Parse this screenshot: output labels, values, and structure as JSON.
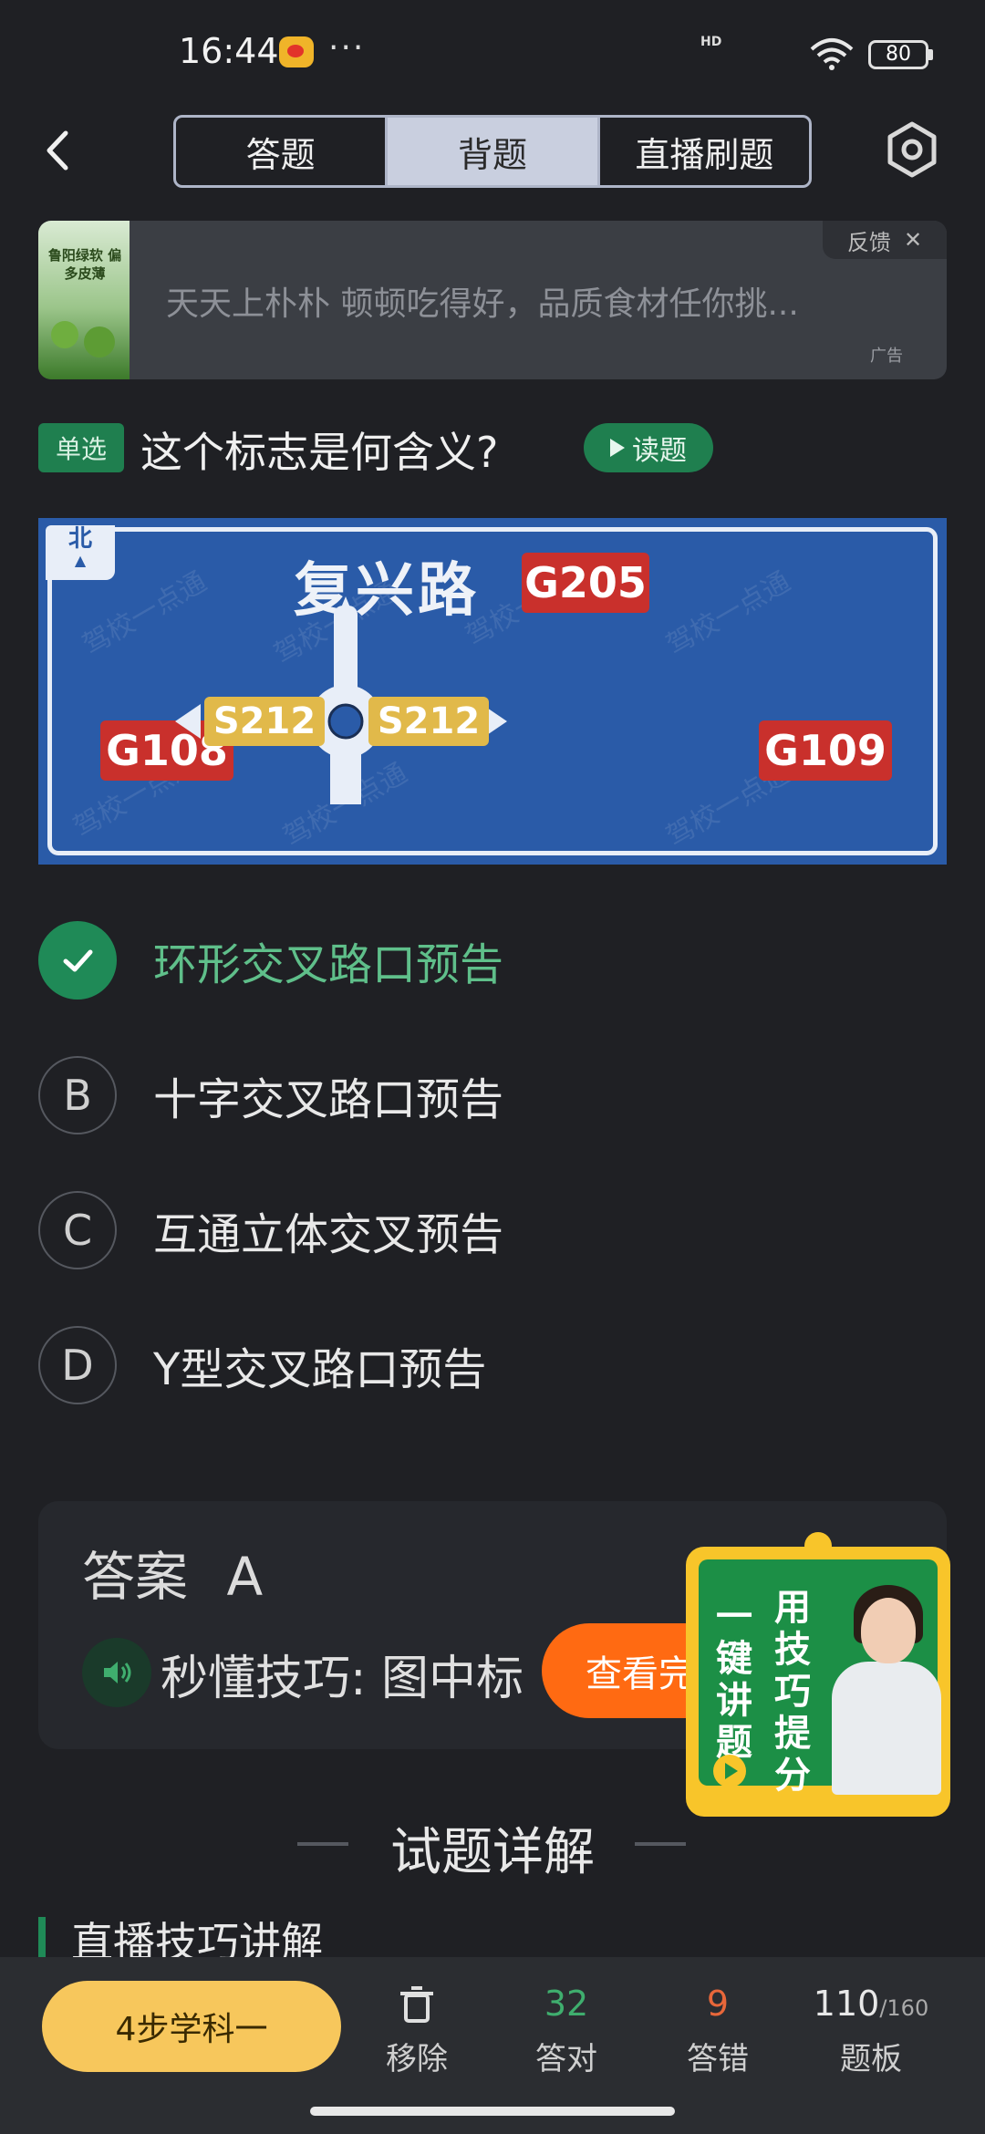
{
  "status": {
    "time": "16:44",
    "more": "···",
    "signal_tag": "HD",
    "battery": "80"
  },
  "header": {
    "tabs": [
      {
        "label": "答题"
      },
      {
        "label": "背题",
        "active": true
      },
      {
        "label": "直播刷题"
      }
    ]
  },
  "ad": {
    "text": "天天上朴朴 顿顿吃得好，品质食材任你挑...",
    "thumb_text": "鲁阳绿软 偏多皮薄",
    "feedback": "反馈",
    "close": "✕",
    "tag": "广告"
  },
  "question": {
    "type": "单选",
    "text": "这个标志是何含义?",
    "read_label": "读题"
  },
  "sign": {
    "north": "北",
    "road": "复兴路",
    "route_top": "G205",
    "route_left": "G108",
    "route_right": "G109",
    "inner_left": "S212",
    "inner_right": "S212",
    "watermark": "驾校一点通",
    "colors": {
      "background": "#2a5ba8",
      "red": "#c9302c",
      "yellow": "#e1b94a"
    }
  },
  "options": [
    {
      "mark": "A",
      "text": "环形交叉路口预告",
      "correct": true
    },
    {
      "mark": "B",
      "text": "十字交叉路口预告"
    },
    {
      "mark": "C",
      "text": "互通立体交叉预告"
    },
    {
      "mark": "D",
      "text": "Y型交叉路口预告"
    }
  ],
  "answer": {
    "label": "答案",
    "value": "A",
    "tip": "秒懂技巧: 图中标",
    "view_button": "查看完"
  },
  "promo": {
    "col1": "一键讲题",
    "col2": "用技巧提分"
  },
  "detail": {
    "title": "试题详解",
    "live_title": "直播技巧讲解"
  },
  "bottom": {
    "study_button": "4步学科一",
    "remove_label": "移除",
    "correct_count": "32",
    "correct_label": "答对",
    "wrong_count": "9",
    "wrong_label": "答错",
    "board_count": "110",
    "board_total": "/160",
    "board_label": "题板"
  }
}
